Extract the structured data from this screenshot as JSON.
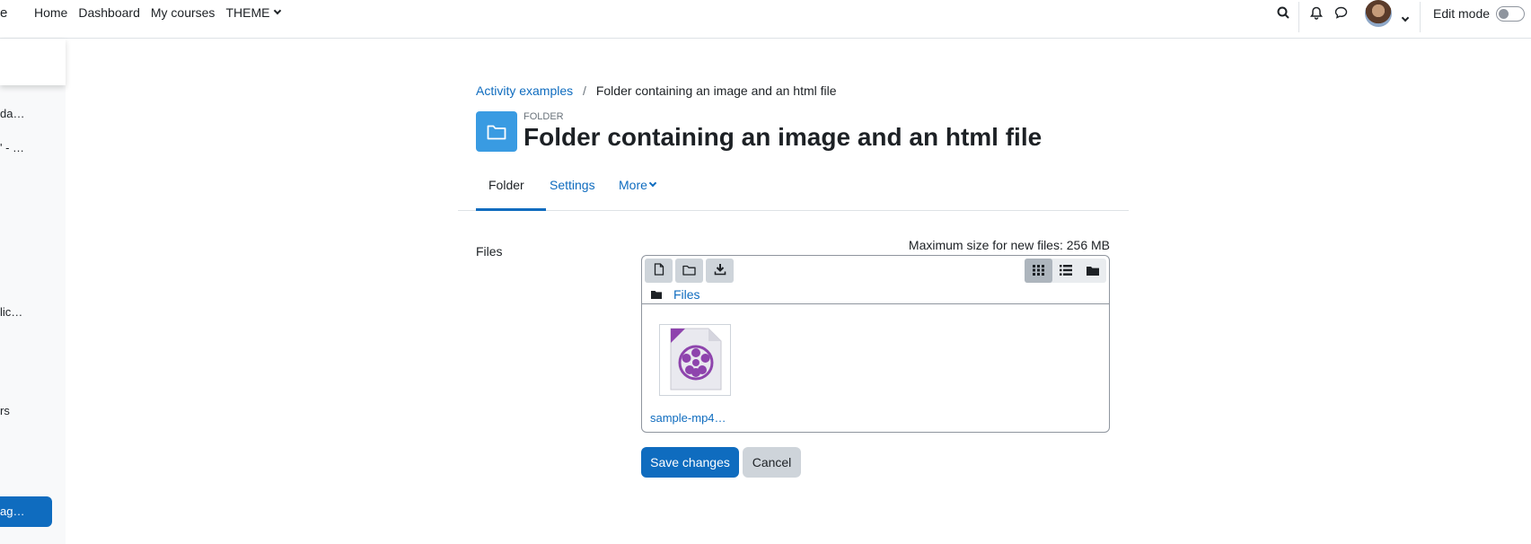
{
  "navbar": {
    "brand_fragment": "e",
    "links": [
      "Home",
      "Dashboard",
      "My courses",
      "THEME"
    ],
    "edit_mode_label": "Edit mode",
    "edit_mode_on": false
  },
  "drawer": {
    "items": [
      "da…",
      "' - …",
      "lic…",
      "rs"
    ],
    "active_item": "ag…"
  },
  "breadcrumb": {
    "parent": "Activity examples",
    "separator": "/",
    "current": "Folder containing an image and an html file"
  },
  "header": {
    "pre_title": "FOLDER",
    "title": "Folder containing an image and an html file"
  },
  "tabs": {
    "folder": "Folder",
    "settings": "Settings",
    "more": "More"
  },
  "form": {
    "files_label": "Files",
    "max_size": "Maximum size for new files: 256 MB",
    "path_label": "Files",
    "file_name": "sample-mp4…",
    "save_label": "Save changes",
    "cancel_label": "Cancel"
  },
  "colors": {
    "primary": "#0f6cbf",
    "folder_icon_bg": "#399be2",
    "video_icon": "#8e44ad"
  }
}
